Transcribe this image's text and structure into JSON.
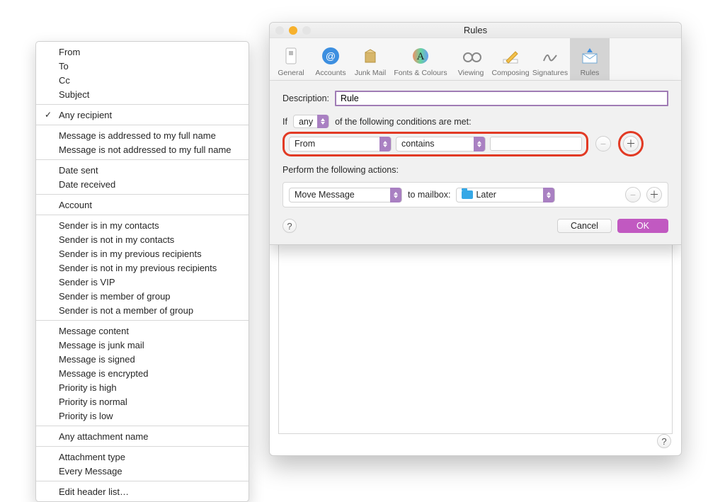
{
  "dropdown": {
    "groups": [
      [
        "From",
        "To",
        "Cc",
        "Subject"
      ],
      [
        "Any recipient"
      ],
      [
        "Message is addressed to my full name",
        "Message is not addressed to my full name"
      ],
      [
        "Date sent",
        "Date received"
      ],
      [
        "Account"
      ],
      [
        "Sender is in my contacts",
        "Sender is not in my contacts",
        "Sender is in my previous recipients",
        "Sender is not in my previous recipients",
        "Sender is VIP",
        "Sender is member of group",
        "Sender is not a member of group"
      ],
      [
        "Message content",
        "Message is junk mail",
        "Message is signed",
        "Message is encrypted",
        "Priority is high",
        "Priority is normal",
        "Priority is low"
      ],
      [
        "Any attachment name"
      ],
      [
        "Attachment type",
        "Every Message"
      ],
      [
        "Edit header list…"
      ]
    ],
    "checked": "Any recipient"
  },
  "window": {
    "title": "Rules",
    "toolbar": [
      {
        "label": "General",
        "key": "general"
      },
      {
        "label": "Accounts",
        "key": "accounts"
      },
      {
        "label": "Junk Mail",
        "key": "junk"
      },
      {
        "label": "Fonts & Colours",
        "key": "fonts",
        "wide": true
      },
      {
        "label": "Viewing",
        "key": "viewing"
      },
      {
        "label": "Composing",
        "key": "composing"
      },
      {
        "label": "Signatures",
        "key": "signatures"
      },
      {
        "label": "Rules",
        "key": "rules",
        "selected": true
      }
    ]
  },
  "sheet": {
    "description_label": "Description:",
    "description_value": "Rule",
    "if_label": "If",
    "if_mode": "any",
    "if_tail": "of the following conditions are met:",
    "condition": {
      "field": "From",
      "operator": "contains",
      "value": ""
    },
    "actions_label": "Perform the following actions:",
    "action": {
      "verb": "Move Message",
      "to_mailbox_label": "to mailbox:",
      "target": "Later"
    },
    "cancel": "Cancel",
    "ok": "OK",
    "help": "?"
  }
}
